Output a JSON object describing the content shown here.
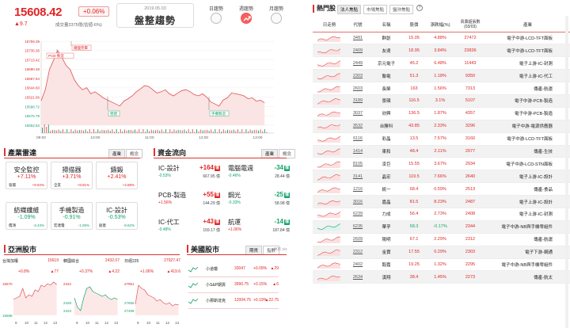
{
  "index": {
    "value": "15608.42",
    "change_pct": "+0.06%",
    "change": "▲9.7",
    "volume": "成交量2375億(估値-6%)"
  },
  "trend": {
    "date": "2019.05.03",
    "title": "盤整趨勢",
    "tabs": [
      "日趨勢",
      "週趨勢",
      "月趨勢"
    ],
    "active": "週趨勢"
  },
  "chart_data": {
    "type": "line",
    "y_ticks": [
      "15759.39",
      "15736.36",
      "15713.42",
      "15690.48",
      "15667.54",
      "15644.60",
      "15621.66",
      "15598.72",
      "15575.78",
      "15552.84"
    ],
    "x_ticks": [
      "09:00",
      "10:00",
      "11:00",
      "12:00",
      "13:00"
    ],
    "ylim": [
      15552.84,
      15759.39
    ],
    "values": [
      15613,
      15640,
      15690,
      15713,
      15736,
      15720,
      15700,
      15690,
      15665,
      15650,
      15640,
      15645,
      15630,
      15635,
      15628,
      15620,
      15615,
      15610,
      15605,
      15600,
      15612,
      15618,
      15625,
      15635,
      15642,
      15650,
      15648,
      15640,
      15632,
      15635,
      15640,
      15630,
      15625,
      15632,
      15638,
      15640,
      15635,
      15628,
      15625,
      15630,
      15622,
      15610,
      15605,
      15600,
      15615,
      15620,
      15632,
      15630,
      15628,
      15625,
      15618,
      15620,
      15612,
      15614,
      15608
    ],
    "annotations": [
      "穩盤完畢",
      "PCB-製造",
      "營建",
      "手機製造"
    ]
  },
  "industry": {
    "title": "產業雷達",
    "tabs": [
      "產業",
      "概念"
    ],
    "cards": [
      {
        "name": "安全監控",
        "pct": "+7.11%",
        "sub_name": "晉揚",
        "sub_pct": "+9.94%"
      },
      {
        "name": "掃描器",
        "pct": "+3.71%",
        "sub_name": "全友",
        "sub_pct": "+9.81%"
      },
      {
        "name": "鑄鍛",
        "pct": "+2.41%",
        "sub_name": "",
        "sub_pct": "+3.88%"
      },
      {
        "name": "紡織纖維",
        "pct": "-1.09%",
        "sub_name": "儒鴻",
        "sub_pct": "-3.43%"
      },
      {
        "name": "手機製造",
        "pct": "-0.91%",
        "sub_name": "宏達電",
        "sub_pct": "-1.05%"
      },
      {
        "name": "IC-設計",
        "pct": "-0.53%",
        "sub_name": "創意",
        "sub_pct": "-9.62%"
      }
    ]
  },
  "fundflow": {
    "title": "資金流向",
    "tabs": [
      "產業",
      "概念"
    ],
    "items": [
      {
        "name": "IC-設計",
        "value": "+164",
        "pct": "-0.53%",
        "amount": "667.95 億",
        "dir": "up"
      },
      {
        "name": "電腦電週",
        "value": "-34",
        "pct": "-0.46%",
        "amount": "28.44 億",
        "dir": "down"
      },
      {
        "name": "PCB-製造",
        "value": "+55",
        "pct": "+1.56%",
        "amount": "144.29 億",
        "dir": "up"
      },
      {
        "name": "鋼光",
        "value": "-25",
        "pct": "-0.33%",
        "amount": "58.98 億",
        "dir": "down"
      },
      {
        "name": "IC-代工",
        "value": "+43",
        "pct": "-0.48%",
        "amount": "159.17 億",
        "dir": "up"
      },
      {
        "name": "航運",
        "value": "-14",
        "pct": "+1.06%",
        "amount": "187.84 億",
        "dir": "down"
      }
    ]
  },
  "asia": {
    "title": "亞洲股市",
    "markets": [
      {
        "name": "台灣加權",
        "value": "15619",
        "pct": "+0.8%",
        "chg": "▲77",
        "top": "15670",
        "bottom": "15568",
        "xlabels": [
          "9",
          "10",
          "11",
          "12",
          "13"
        ]
      },
      {
        "name": "韓國綜合",
        "value": "2432.07",
        "pct": "+0.37%",
        "chg": "▲4.22",
        "top": "2442",
        "mid1": "2428",
        "mid2": "2423",
        "xlabels": [
          "9",
          "10",
          "11",
          "12",
          "13"
        ]
      },
      {
        "name": "日經225",
        "value": "27927.47",
        "pct": "+1.06%",
        "chg": "▲419.6",
        "top": "27961",
        "mid1": "27655",
        "mid2": "27499",
        "xlabels": [
          "9",
          "10",
          "11",
          "12",
          "13"
        ]
      }
    ]
  },
  "us": {
    "title": "美國股市",
    "tabs": [
      "期貨",
      "指數"
    ],
    "update": "更新 3/3",
    "rows": [
      {
        "name": "小道瓊",
        "value": "33047",
        "pct": "+0.09%",
        "chg": "▲29"
      },
      {
        "name": "小S&P期貨",
        "value": "3990.75",
        "pct": "+0.15%",
        "chg": "▲6"
      },
      {
        "name": "小那斯達克",
        "value": "12004.75",
        "pct": "+0.19%",
        "chg": "▲22.75"
      }
    ]
  },
  "hot": {
    "title": "熱門股",
    "tabs": [
      "法人焦點",
      "市場焦點",
      "盤沖焦點"
    ],
    "columns": [
      "日走勢",
      "代號",
      "名稱",
      "股價",
      "漲跌幅(%)",
      "成交量",
      "買賣超張數(03/03)",
      "產業"
    ],
    "rows": [
      {
        "code": "3481",
        "name": "群創",
        "price": "15.05",
        "pct": "4.88%",
        "vol": "27472",
        "ind": "電子中游-LCD-TFT面板",
        "dir": "up"
      },
      {
        "code": "2409",
        "name": "友達",
        "price": "18.95",
        "pct": "3.84%",
        "vol": "23836",
        "ind": "電子中游-LCD-TFT面板",
        "dir": "up"
      },
      {
        "code": "2449",
        "name": "京元電子",
        "price": "45.2",
        "pct": "6.48%",
        "vol": "11443",
        "ind": "電子上游-IC-封測",
        "dir": "up"
      },
      {
        "code": "2303",
        "name": "聯電",
        "price": "51.3",
        "pct": "1.18%",
        "vol": "9350",
        "ind": "電子上游-IC-代工",
        "dir": "up"
      },
      {
        "code": "2603",
        "name": "長榮",
        "price": "163",
        "pct": "1.56%",
        "vol": "7313",
        "ind": "傳產-航運",
        "dir": "up"
      },
      {
        "code": "3189",
        "name": "景碩",
        "price": "116.5",
        "pct": "3.1%",
        "vol": "5107",
        "ind": "電子中游-PCB-製造",
        "dir": "up"
      },
      {
        "code": "3037",
        "name": "欣興",
        "price": "136.5",
        "pct": "1.87%",
        "vol": "4357",
        "ind": "電子中游-PCB-製造",
        "dir": "up"
      },
      {
        "code": "3532",
        "name": "台勝科",
        "price": "43.85",
        "pct": "2.33%",
        "vol": "3296",
        "ind": "電子中游-電源供應器",
        "dir": "up"
      },
      {
        "code": "6116",
        "name": "彩晶",
        "price": "13.5",
        "pct": "7.57%",
        "vol": "3160",
        "ind": "電子中游-LCD-TFT面板",
        "dir": "up"
      },
      {
        "code": "1414",
        "name": "東和",
        "price": "48.4",
        "pct": "2.11%",
        "vol": "2977",
        "ind": "傳產-生技",
        "dir": "up"
      },
      {
        "code": "8105",
        "name": "凌巨",
        "price": "15.55",
        "pct": "3.67%",
        "vol": "2934",
        "ind": "電子中游-LCD-STN面板",
        "dir": "up"
      },
      {
        "code": "3141",
        "name": "晶宏",
        "price": "119.5",
        "pct": "7.66%",
        "vol": "2640",
        "ind": "電子上游-IC-設計",
        "dir": "up"
      },
      {
        "code": "1216",
        "name": "統一",
        "price": "68.4",
        "pct": "0.59%",
        "vol": "2513",
        "ind": "傳產-食品",
        "dir": "up"
      },
      {
        "code": "3016",
        "name": "嘉晶",
        "price": "81.5",
        "pct": "8.23%",
        "vol": "2487",
        "ind": "電子上游-IC-設計",
        "dir": "up"
      },
      {
        "code": "6239",
        "name": "力成",
        "price": "56.4",
        "pct": "2.73%",
        "vol": "2408",
        "ind": "電子上游-IC-封測",
        "dir": "up"
      },
      {
        "code": "6235",
        "name": "華孚",
        "price": "58.3",
        "pct": "-0.17%",
        "vol": "2344",
        "ind": "電子中游-NB與手機零組件",
        "dir": "down"
      },
      {
        "code": "2609",
        "name": "陽明",
        "price": "67.1",
        "pct": "2.29%",
        "vol": "2312",
        "ind": "傳產-航運",
        "dir": "up"
      },
      {
        "code": "2312",
        "name": "金寶",
        "price": "17.55",
        "pct": "0.29%",
        "vol": "2303",
        "ind": "電子下游-網通",
        "dir": "up"
      },
      {
        "code": "2402",
        "name": "毅嘉",
        "price": "19.25",
        "pct": "1.32%",
        "vol": "2295",
        "ind": "電子中游-NB與手機零組件",
        "dir": "up"
      },
      {
        "code": "2634",
        "name": "漢翔",
        "price": "38.4",
        "pct": "1.45%",
        "vol": "2273",
        "ind": "傳產-航太",
        "dir": "up"
      }
    ]
  }
}
